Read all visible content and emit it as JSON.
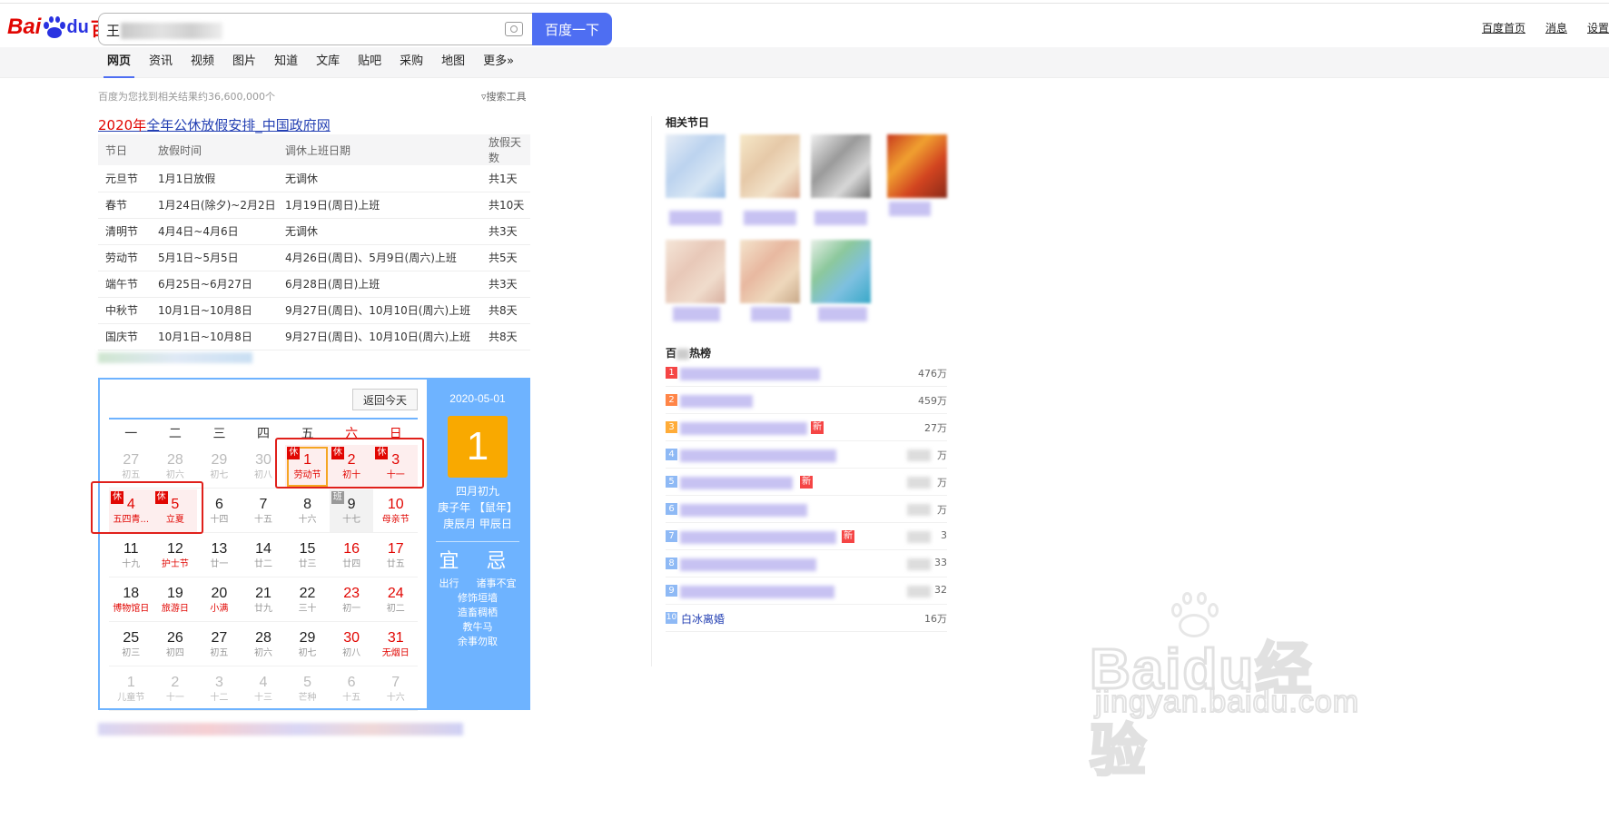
{
  "header": {
    "logo_bai": "Bai",
    "logo_du": "du",
    "logo_cn": "百度",
    "query_prefix": "王",
    "search_button": "百度一下",
    "toplinks": [
      "百度首页",
      "消息",
      "设置"
    ]
  },
  "tabs": [
    "网页",
    "资讯",
    "视频",
    "图片",
    "知道",
    "文库",
    "贴吧",
    "采购",
    "地图",
    "更多»"
  ],
  "active_tab": "网页",
  "result_count": "百度为您找到相关结果约36,600,000个",
  "search_tools": "搜索工具",
  "result": {
    "title_red": "2020年",
    "title_rest": "全年公休放假安排_中国政府网",
    "headers": [
      "节日",
      "放假时间",
      "调休上班日期",
      "放假天数"
    ],
    "rows": [
      [
        "元旦节",
        "1月1日放假",
        "无调休",
        "共1天"
      ],
      [
        "春节",
        "1月24日(除夕)~2月2日",
        "1月19日(周日)上班",
        "共10天"
      ],
      [
        "清明节",
        "4月4日~4月6日",
        "无调休",
        "共3天"
      ],
      [
        "劳动节",
        "5月1日~5月5日",
        "4月26日(周日)、5月9日(周六)上班",
        "共5天"
      ],
      [
        "端午节",
        "6月25日~6月27日",
        "6月28日(周日)上班",
        "共3天"
      ],
      [
        "中秋节",
        "10月1日~10月8日",
        "9月27日(周日)、10月10日(周六)上班",
        "共8天"
      ],
      [
        "国庆节",
        "10月1日~10月8日",
        "9月27日(周日)、10月10日(周六)上班",
        "共8天"
      ]
    ]
  },
  "calendar": {
    "back_today": "返回今天",
    "weekdays": [
      "一",
      "二",
      "三",
      "四",
      "五",
      "六",
      "日"
    ],
    "days": [
      {
        "n": "27",
        "l": "初五",
        "other": true
      },
      {
        "n": "28",
        "l": "初六",
        "other": true
      },
      {
        "n": "29",
        "l": "初七",
        "other": true
      },
      {
        "n": "30",
        "l": "初八",
        "other": true
      },
      {
        "n": "1",
        "l": "劳动节",
        "rest": true,
        "tag": "休",
        "selected": true
      },
      {
        "n": "2",
        "l": "初十",
        "rest": true,
        "tag": "休"
      },
      {
        "n": "3",
        "l": "十一",
        "rest": true,
        "tag": "休"
      },
      {
        "n": "4",
        "l": "五四青...",
        "rest": true,
        "tag": "休"
      },
      {
        "n": "5",
        "l": "立夏",
        "rest": true,
        "tag": "休"
      },
      {
        "n": "6",
        "l": "十四"
      },
      {
        "n": "7",
        "l": "十五"
      },
      {
        "n": "8",
        "l": "十六"
      },
      {
        "n": "9",
        "l": "十七",
        "work": true,
        "tag": "班"
      },
      {
        "n": "10",
        "l": "母亲节",
        "weekend": true,
        "fest": true
      },
      {
        "n": "11",
        "l": "十九"
      },
      {
        "n": "12",
        "l": "护士节",
        "fest": true
      },
      {
        "n": "13",
        "l": "廿一"
      },
      {
        "n": "14",
        "l": "廿二"
      },
      {
        "n": "15",
        "l": "廿三"
      },
      {
        "n": "16",
        "l": "廿四",
        "weekend": true
      },
      {
        "n": "17",
        "l": "廿五",
        "weekend": true
      },
      {
        "n": "18",
        "l": "博物馆日",
        "fest": true
      },
      {
        "n": "19",
        "l": "旅游日",
        "fest": true
      },
      {
        "n": "20",
        "l": "小满",
        "fest": true
      },
      {
        "n": "21",
        "l": "廿九"
      },
      {
        "n": "22",
        "l": "三十"
      },
      {
        "n": "23",
        "l": "初一",
        "weekend": true
      },
      {
        "n": "24",
        "l": "初二",
        "weekend": true
      },
      {
        "n": "25",
        "l": "初三"
      },
      {
        "n": "26",
        "l": "初四"
      },
      {
        "n": "27",
        "l": "初五"
      },
      {
        "n": "28",
        "l": "初六"
      },
      {
        "n": "29",
        "l": "初七"
      },
      {
        "n": "30",
        "l": "初八",
        "weekend": true
      },
      {
        "n": "31",
        "l": "无烟日",
        "weekend": true,
        "fest": true
      },
      {
        "n": "1",
        "l": "儿童节",
        "other": true
      },
      {
        "n": "2",
        "l": "十一",
        "other": true
      },
      {
        "n": "3",
        "l": "十二",
        "other": true
      },
      {
        "n": "4",
        "l": "十三",
        "other": true
      },
      {
        "n": "5",
        "l": "芒种",
        "other": true
      },
      {
        "n": "6",
        "l": "十五",
        "other": true
      },
      {
        "n": "7",
        "l": "十六",
        "other": true
      }
    ],
    "side": {
      "date": "2020-05-01",
      "big_day": "1",
      "lunar1": "四月初九",
      "lunar2": "庚子年 【鼠年】",
      "lunar3": "庚辰月 甲辰日",
      "yi_title": "宜",
      "ji_title": "忌",
      "yi_1": "出行",
      "ji_1": "诸事不宜",
      "yi_items": [
        "修饰垣墙",
        "造畜稠栖",
        "教牛马",
        "余事勿取"
      ]
    }
  },
  "related": {
    "title": "相关节日"
  },
  "hot": {
    "title_start": "百",
    "title_end": "热榜",
    "rows": [
      {
        "rank": "1",
        "text": "",
        "count": "476万",
        "new": false
      },
      {
        "rank": "2",
        "text": "",
        "count": "459万",
        "new": false
      },
      {
        "rank": "3",
        "text": "",
        "count": "27万",
        "new": true
      },
      {
        "rank": "4",
        "text": "",
        "count": "万",
        "new": false
      },
      {
        "rank": "5",
        "text": "",
        "count": "万",
        "new": true
      },
      {
        "rank": "6",
        "text": "",
        "count": "万",
        "new": false
      },
      {
        "rank": "7",
        "text": "",
        "count": "3",
        "new": true
      },
      {
        "rank": "8",
        "text": "",
        "count": "33",
        "new": false
      },
      {
        "rank": "9",
        "text": "",
        "count": "32",
        "new": false
      },
      {
        "rank": "10",
        "text": "白冰离婚",
        "count": "16万",
        "new": false
      }
    ]
  },
  "watermark": {
    "word": "Baidu经验",
    "url": "jingyan.baidu.com"
  },
  "colors": {
    "brand_blue": "#4e6ef2",
    "brand_red": "#e10602",
    "calendar_blue": "#6eb3ff",
    "highlight_orange": "#f9a900"
  }
}
